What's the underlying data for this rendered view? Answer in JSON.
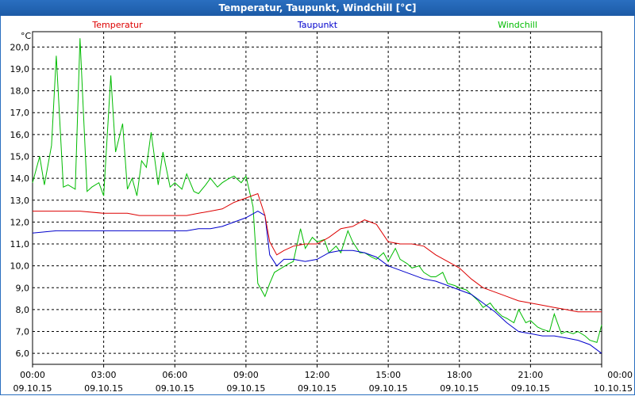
{
  "window": {
    "title": "Temperatur, Taupunkt, Windchill [°C]"
  },
  "chart_data": {
    "type": "line",
    "title": "Temperatur, Taupunkt, Windchill [°C]",
    "ylabel": "°C",
    "xlabel": "",
    "xlim": [
      0,
      24
    ],
    "ylim": [
      5.5,
      20.7
    ],
    "grid": true,
    "legend_placement": "top",
    "x_ticks": [
      {
        "time": "00:00",
        "date": "09.10.15"
      },
      {
        "time": "03:00",
        "date": "09.10.15"
      },
      {
        "time": "06:00",
        "date": "09.10.15"
      },
      {
        "time": "09:00",
        "date": "09.10.15"
      },
      {
        "time": "12:00",
        "date": "09.10.15"
      },
      {
        "time": "15:00",
        "date": "09.10.15"
      },
      {
        "time": "18:00",
        "date": "09.10.15"
      },
      {
        "time": "21:00",
        "date": "09.10.15"
      },
      {
        "time": "00:00",
        "date": "10.10.15"
      }
    ],
    "y_ticks": [
      "6,0",
      "7,0",
      "8,0",
      "9,0",
      "10,0",
      "11,0",
      "12,0",
      "13,0",
      "14,0",
      "15,0",
      "16,0",
      "17,0",
      "18,0",
      "19,0",
      "20,0"
    ],
    "series": [
      {
        "name": "Temperatur",
        "color": "#dd0000",
        "x": [
          0,
          1,
          2,
          3,
          4,
          4.5,
          5,
          5.5,
          6,
          6.5,
          7,
          7.5,
          8,
          8.5,
          9,
          9.5,
          9.8,
          10,
          10.3,
          10.6,
          11,
          11.5,
          12,
          12.5,
          13,
          13.5,
          14,
          14.5,
          15,
          15.5,
          16,
          16.5,
          17,
          17.5,
          18,
          18.5,
          19,
          19.5,
          20,
          20.5,
          21,
          21.5,
          22,
          22.5,
          23,
          23.5,
          24
        ],
        "values": [
          12.5,
          12.5,
          12.5,
          12.4,
          12.4,
          12.3,
          12.3,
          12.3,
          12.3,
          12.3,
          12.4,
          12.5,
          12.6,
          12.9,
          13.1,
          13.3,
          12.3,
          11.1,
          10.5,
          10.7,
          10.9,
          11.0,
          11.0,
          11.3,
          11.7,
          11.8,
          12.1,
          11.9,
          11.1,
          11.0,
          11.0,
          10.9,
          10.5,
          10.2,
          9.9,
          9.4,
          9.0,
          8.8,
          8.6,
          8.4,
          8.3,
          8.2,
          8.1,
          8.0,
          7.9,
          7.9,
          7.9
        ]
      },
      {
        "name": "Taupunkt",
        "color": "#0000cc",
        "x": [
          0,
          1,
          2,
          3,
          4,
          4.5,
          5,
          5.5,
          6,
          6.5,
          7,
          7.5,
          8,
          8.5,
          9,
          9.5,
          9.8,
          10,
          10.3,
          10.6,
          11,
          11.5,
          12,
          12.5,
          13,
          13.5,
          14,
          14.5,
          15,
          15.5,
          16,
          16.5,
          17,
          17.5,
          18,
          18.5,
          19,
          19.5,
          20,
          20.5,
          21,
          21.5,
          22,
          22.5,
          23,
          23.5,
          24
        ],
        "values": [
          11.5,
          11.6,
          11.6,
          11.6,
          11.6,
          11.6,
          11.6,
          11.6,
          11.6,
          11.6,
          11.7,
          11.7,
          11.8,
          12.0,
          12.2,
          12.5,
          12.3,
          10.5,
          10.0,
          10.3,
          10.3,
          10.2,
          10.3,
          10.6,
          10.7,
          10.7,
          10.6,
          10.4,
          10.0,
          9.8,
          9.6,
          9.4,
          9.3,
          9.1,
          8.9,
          8.7,
          8.3,
          7.9,
          7.4,
          7.0,
          6.9,
          6.8,
          6.8,
          6.7,
          6.6,
          6.4,
          6.0
        ]
      },
      {
        "name": "Windchill",
        "color": "#00bb00",
        "x": [
          0,
          0.3,
          0.5,
          0.8,
          1.0,
          1.3,
          1.5,
          1.8,
          2.0,
          2.3,
          2.5,
          2.8,
          3.0,
          3.3,
          3.5,
          3.8,
          4.0,
          4.2,
          4.4,
          4.6,
          4.8,
          5.0,
          5.3,
          5.5,
          5.8,
          6.0,
          6.3,
          6.5,
          6.8,
          7.0,
          7.3,
          7.5,
          7.8,
          8.0,
          8.3,
          8.5,
          8.8,
          9.0,
          9.3,
          9.5,
          9.8,
          10.0,
          10.2,
          10.5,
          10.8,
          11.0,
          11.3,
          11.5,
          11.8,
          12.0,
          12.3,
          12.5,
          12.8,
          13.0,
          13.3,
          13.5,
          13.8,
          14.0,
          14.3,
          14.5,
          14.8,
          15.0,
          15.3,
          15.5,
          15.8,
          16.0,
          16.3,
          16.5,
          16.8,
          17.0,
          17.3,
          17.5,
          17.8,
          18.0,
          18.3,
          18.5,
          18.8,
          19.0,
          19.3,
          19.5,
          19.8,
          20.0,
          20.3,
          20.5,
          20.8,
          21.0,
          21.3,
          21.5,
          21.8,
          22.0,
          22.3,
          22.5,
          22.8,
          23.0,
          23.3,
          23.5,
          23.8,
          24.0
        ],
        "values": [
          13.8,
          15.0,
          13.7,
          15.5,
          19.6,
          13.6,
          13.7,
          13.5,
          20.4,
          13.4,
          13.6,
          13.8,
          13.2,
          18.7,
          15.2,
          16.5,
          13.5,
          14.0,
          13.2,
          14.8,
          14.5,
          16.1,
          13.7,
          15.2,
          13.6,
          13.8,
          13.5,
          14.2,
          13.4,
          13.3,
          13.7,
          14.0,
          13.6,
          13.8,
          14.0,
          14.1,
          13.8,
          14.1,
          12.7,
          9.2,
          8.6,
          9.2,
          9.7,
          9.9,
          10.1,
          10.2,
          11.7,
          10.8,
          11.3,
          11.1,
          11.2,
          10.6,
          10.9,
          10.6,
          11.6,
          11.1,
          10.6,
          10.6,
          10.4,
          10.3,
          10.6,
          10.2,
          10.8,
          10.3,
          10.1,
          9.9,
          10.0,
          9.7,
          9.5,
          9.5,
          9.7,
          9.2,
          9.1,
          9.0,
          8.9,
          8.7,
          8.4,
          8.1,
          8.3,
          8.0,
          7.7,
          7.6,
          7.4,
          8.0,
          7.4,
          7.5,
          7.2,
          7.1,
          7.0,
          7.8,
          6.9,
          7.0,
          6.9,
          7.0,
          6.8,
          6.6,
          6.5,
          7.3
        ]
      }
    ]
  }
}
